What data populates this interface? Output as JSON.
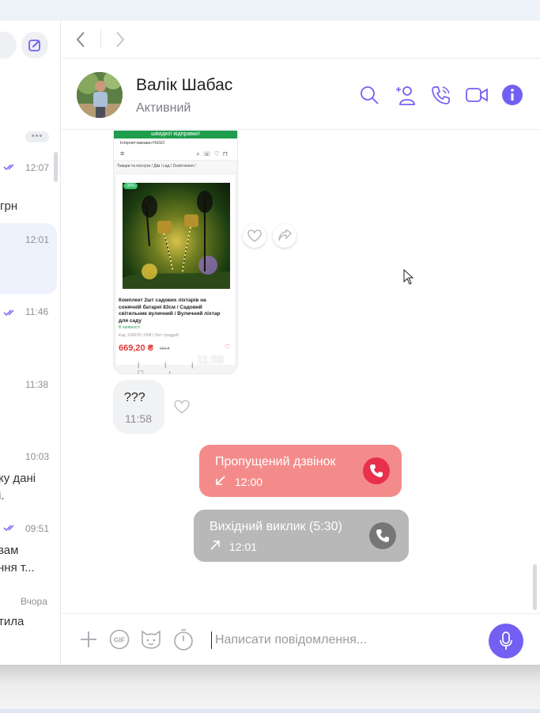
{
  "contact": {
    "name": "Валік Шабас",
    "status": "Активний"
  },
  "chat_list": {
    "more_label": "•••",
    "items": [
      {
        "time": "12:07",
        "snippet": "грн",
        "read": true
      },
      {
        "time": "12:01",
        "snippet": "",
        "read": false
      },
      {
        "time": "11:46",
        "snippet": "",
        "read": true
      },
      {
        "time": "11:38",
        "snippet": "",
        "read": false
      },
      {
        "time": "10:03",
        "snippet": "ку дані\nі.",
        "read": false
      },
      {
        "time": "09:51",
        "snippet": "вам\nння т...",
        "read": true
      },
      {
        "time": "Вчора",
        "snippet": "тила",
        "read": false
      }
    ]
  },
  "image_message": {
    "banner": "швидкої відправки!",
    "store": "Інтернет-магазин HUGO",
    "breadcrumbs": "Товари та послуги  /  Дім і сад  /  Освітлення  /",
    "badge": "-30%",
    "product_title": "Комплект 2шт садових ліхтарів на сонячній батареї 83см / Садовий світильник вуличний / Вуличний ліхтар для саду",
    "stock": "В наявності",
    "code": "Код: 234578 | Ohtf | Опт і роздріб",
    "price": "669,20 ₴",
    "old_price": "956 ₴",
    "time": "11:58"
  },
  "messages": [
    {
      "text": "???",
      "time": "11:58"
    }
  ],
  "calls": [
    {
      "label": "Пропущений дзвінок",
      "time": "12:00",
      "type": "missed",
      "color": "#f48b8b",
      "icon_color": "#e8304c"
    },
    {
      "label": "Вихідний виклик  (5:30)",
      "time": "12:01",
      "type": "outgoing",
      "color": "#b8b8b8",
      "icon_color": "#767676"
    }
  ],
  "composer": {
    "placeholder": "Написати повідомлення..."
  },
  "colors": {
    "accent": "#7360f2"
  },
  "icons": [
    "compose-icon",
    "back-icon",
    "forward-icon",
    "search-icon",
    "add-participant-icon",
    "voice-call-icon",
    "video-call-icon",
    "info-icon",
    "heart-icon",
    "share-icon",
    "plus-icon",
    "gif-icon",
    "sticker-icon",
    "timer-icon",
    "mic-icon"
  ]
}
